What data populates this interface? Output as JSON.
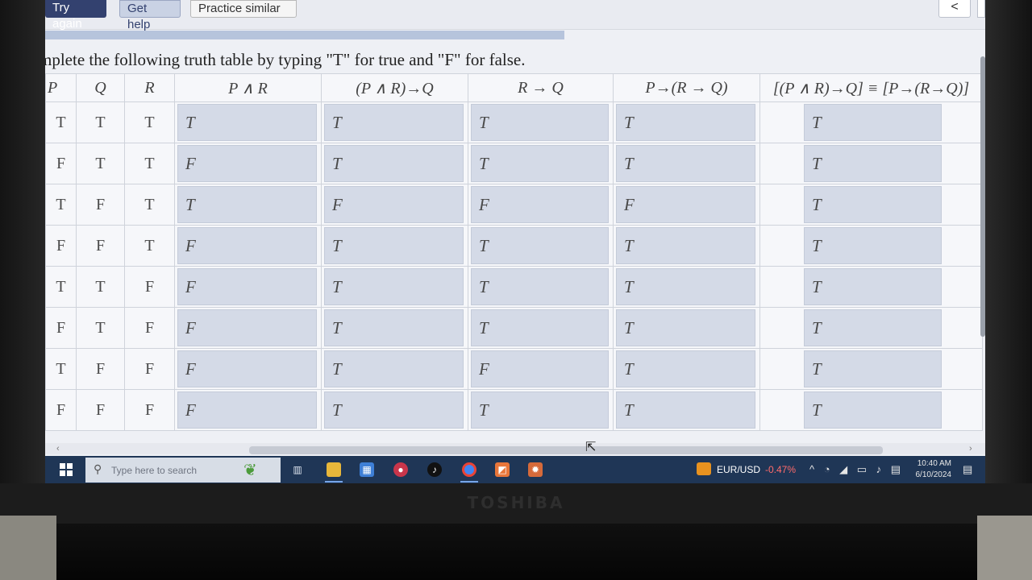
{
  "toolbar": {
    "try_again": "Try again",
    "get_help": "Get help",
    "practice_similar": "Practice similar",
    "back_glyph": "<"
  },
  "question": {
    "instruction": "mplete the following truth table by typing \"T\" for true and \"F\" for false."
  },
  "truth_table": {
    "headers": [
      "P",
      "Q",
      "R",
      "P ∧ R",
      "(P ∧ R)→Q",
      "R → Q",
      "P→(R → Q)",
      "[(P ∧ R)→Q] ≡ [P→(R→Q)]"
    ],
    "rows": [
      {
        "p": "T",
        "q": "T",
        "r": "T",
        "answers": [
          "T",
          "T",
          "T",
          "T",
          "T"
        ]
      },
      {
        "p": "F",
        "q": "T",
        "r": "T",
        "answers": [
          "F",
          "T",
          "T",
          "T",
          "T"
        ]
      },
      {
        "p": "T",
        "q": "F",
        "r": "T",
        "answers": [
          "T",
          "F",
          "F",
          "F",
          "T"
        ]
      },
      {
        "p": "F",
        "q": "F",
        "r": "T",
        "answers": [
          "F",
          "T",
          "T",
          "T",
          "T"
        ]
      },
      {
        "p": "T",
        "q": "T",
        "r": "F",
        "answers": [
          "F",
          "T",
          "T",
          "T",
          "T"
        ]
      },
      {
        "p": "F",
        "q": "T",
        "r": "F",
        "answers": [
          "F",
          "T",
          "T",
          "T",
          "T"
        ]
      },
      {
        "p": "T",
        "q": "F",
        "r": "F",
        "answers": [
          "F",
          "T",
          "F",
          "T",
          "T"
        ]
      },
      {
        "p": "F",
        "q": "F",
        "r": "F",
        "answers": [
          "F",
          "T",
          "T",
          "T",
          "T"
        ]
      }
    ]
  },
  "scrollbar": {
    "left_arrow": "‹",
    "right_arrow": "›"
  },
  "taskbar": {
    "search_placeholder": "Type here to search",
    "apps": [
      "task-view-icon",
      "file-explorer-icon",
      "store-icon",
      "camera-icon",
      "tiktok-icon",
      "chrome-icon",
      "app-orange-icon",
      "settings-icon"
    ],
    "forex_pair": "EUR/USD",
    "forex_change": "-0.47%",
    "time": "10:40 AM",
    "date": "6/10/2024"
  },
  "bezel": {
    "brand": "TOSHIBA"
  },
  "colors": {
    "accent": "#33416f",
    "input_bg": "#d4dae7",
    "taskbar": "#1f3656",
    "negative": "#ff6b6b"
  }
}
